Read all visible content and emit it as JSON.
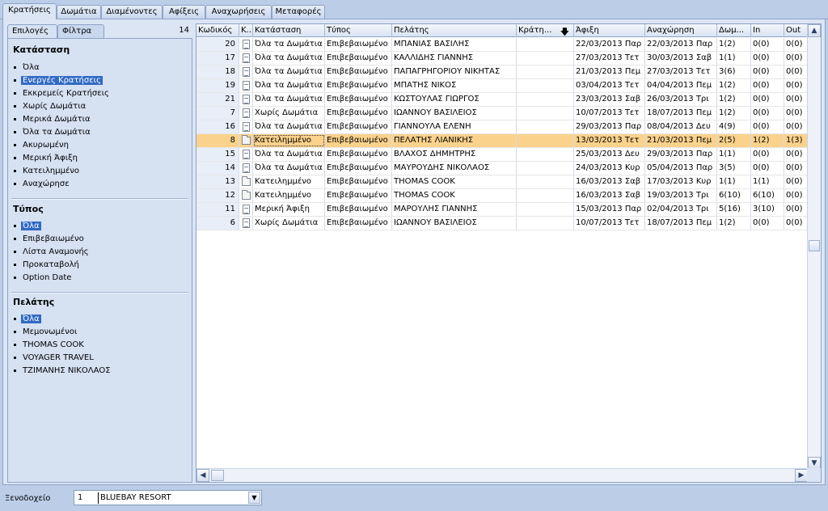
{
  "top_tabs": [
    {
      "label": "Κρατήσεις",
      "active": true
    },
    {
      "label": "Δωμάτια",
      "active": false
    },
    {
      "label": "Διαμένοντες",
      "active": false
    },
    {
      "label": "Αφίξεις",
      "active": false
    },
    {
      "label": "Αναχωρήσεις",
      "active": false
    },
    {
      "label": "Μεταφορές",
      "active": false
    }
  ],
  "left_panel": {
    "tabs": [
      {
        "label": "Επιλογές",
        "active": true
      },
      {
        "label": "Φίλτρα",
        "active": false
      }
    ],
    "count": "14",
    "status_section": {
      "title": "Κατάσταση",
      "items": [
        "Όλα",
        "Ενεργές Κρατήσεις",
        "Εκκρεμείς Κρατήσεις",
        "Χωρίς Δωμάτια",
        "Μερικά Δωμάτια",
        "Όλα τα Δωμάτια",
        "Ακυρωμένη",
        "Μερική Άφιξη",
        "Κατειλημμένο",
        "Αναχώρησε"
      ],
      "selected_index": 1
    },
    "type_section": {
      "title": "Τύπος",
      "items": [
        "Όλα",
        "Επιβεβαιωμένο",
        "Λίστα Αναμονής",
        "Προκαταβολή",
        "Option Date"
      ],
      "selected_index": 0
    },
    "customer_section": {
      "title": "Πελάτης",
      "items": [
        "Όλα",
        "Μεμονωμένοι",
        "THOMAS COOK",
        "VOYAGER TRAVEL",
        "ΤΖΙΜΑΝΗΣ ΝΙΚΟΛΑΟΣ"
      ],
      "selected_index": 0
    }
  },
  "grid": {
    "columns": [
      "Κωδικός",
      "Κ...",
      "Κατάσταση",
      "Τύπος",
      "Πελάτης",
      "Κράτη...",
      "Άφιξη",
      "Αναχώρηση",
      "Δωμ...",
      "In",
      "Out"
    ],
    "sort_icon": "sort-down-arrow",
    "rows": [
      {
        "id": "20",
        "icon": "document",
        "status": "Όλα τα Δωμάτια",
        "type": "Επιβεβαιωμένο",
        "customer": "ΜΠΑΝΙΑΣ ΒΑΣΙΛΗΣ",
        "booked": "",
        "arrival": "22/03/2013 Παρ",
        "departure": "22/03/2013 Παρ",
        "rooms": "1(2)",
        "in": "0(0)",
        "out": "0(0)"
      },
      {
        "id": "17",
        "icon": "document",
        "status": "Όλα τα Δωμάτια",
        "type": "Επιβεβαιωμένο",
        "customer": "ΚΑΛΛΙΔΗΣ ΓΙΑΝΝΗΣ",
        "booked": "",
        "arrival": "27/03/2013 Τετ",
        "departure": "30/03/2013 Σαβ",
        "rooms": "1(1)",
        "in": "0(0)",
        "out": "0(0)"
      },
      {
        "id": "18",
        "icon": "document",
        "status": "Όλα τα Δωμάτια",
        "type": "Επιβεβαιωμένο",
        "customer": "ΠΑΠΑΓΡΗΓΟΡΙΟΥ ΝΙΚΗΤΑΣ",
        "booked": "",
        "arrival": "21/03/2013 Πεμ",
        "departure": "27/03/2013 Τετ",
        "rooms": "3(6)",
        "in": "0(0)",
        "out": "0(0)"
      },
      {
        "id": "19",
        "icon": "document",
        "status": "Όλα τα Δωμάτια",
        "type": "Επιβεβαιωμένο",
        "customer": "ΜΠΑΤΗΣ ΝΙΚΟΣ",
        "booked": "",
        "arrival": "03/04/2013 Τετ",
        "departure": "04/04/2013 Πεμ",
        "rooms": "1(2)",
        "in": "0(0)",
        "out": "0(0)"
      },
      {
        "id": "21",
        "icon": "document",
        "status": "Όλα τα Δωμάτια",
        "type": "Επιβεβαιωμένο",
        "customer": "ΚΩΣΤΟΥΛΑΣ ΓΙΩΡΓΟΣ",
        "booked": "",
        "arrival": "23/03/2013 Σαβ",
        "departure": "26/03/2013 Τρι",
        "rooms": "1(2)",
        "in": "0(0)",
        "out": "0(0)"
      },
      {
        "id": "7",
        "icon": "document",
        "status": "Χωρίς Δωμάτια",
        "type": "Επιβεβαιωμένο",
        "customer": "ΙΩΑΝΝΟΥ ΒΑΣΙΛΕΙΟΣ",
        "booked": "",
        "arrival": "10/07/2013 Τετ",
        "departure": "18/07/2013 Πεμ",
        "rooms": "1(2)",
        "in": "0(0)",
        "out": "0(0)"
      },
      {
        "id": "16",
        "icon": "document",
        "status": "Όλα τα Δωμάτια",
        "type": "Επιβεβαιωμένο",
        "customer": "ΓΙΑΝΝΟΥΛΑ ΕΛΕΝΗ",
        "booked": "",
        "arrival": "29/03/2013 Παρ",
        "departure": "08/04/2013 Δευ",
        "rooms": "4(9)",
        "in": "0(0)",
        "out": "0(0)"
      },
      {
        "id": "8",
        "icon": "folder",
        "status": "Κατειλημμένο",
        "type": "Επιβεβαιωμένο",
        "customer": "ΠΕΛΑΤΗΣ ΛΙΑΝΙΚΗΣ",
        "booked": "",
        "arrival": "13/03/2013 Τετ",
        "departure": "21/03/2013 Πεμ",
        "rooms": "2(5)",
        "in": "1(2)",
        "out": "1(3)",
        "selected": true
      },
      {
        "id": "15",
        "icon": "document",
        "status": "Όλα τα Δωμάτια",
        "type": "Επιβεβαιωμένο",
        "customer": "ΒΛΑΧΟΣ ΔΗΜΗΤΡΗΣ",
        "booked": "",
        "arrival": "25/03/2013 Δευ",
        "departure": "29/03/2013 Παρ",
        "rooms": "1(1)",
        "in": "0(0)",
        "out": "0(0)"
      },
      {
        "id": "14",
        "icon": "document",
        "status": "Όλα τα Δωμάτια",
        "type": "Επιβεβαιωμένο",
        "customer": "ΜΑΥΡΟΥΔΗΣ ΝΙΚΟΛΑΟΣ",
        "booked": "",
        "arrival": "24/03/2013 Κυρ",
        "departure": "05/04/2013 Παρ",
        "rooms": "3(5)",
        "in": "0(0)",
        "out": "0(0)"
      },
      {
        "id": "13",
        "icon": "folder",
        "status": "Κατειλημμένο",
        "type": "Επιβεβαιωμένο",
        "customer": "THOMAS COOK",
        "booked": "",
        "arrival": "16/03/2013 Σαβ",
        "departure": "17/03/2013 Κυρ",
        "rooms": "1(1)",
        "in": "1(1)",
        "out": "0(0)"
      },
      {
        "id": "12",
        "icon": "folder",
        "status": "Κατειλημμένο",
        "type": "Επιβεβαιωμένο",
        "customer": "THOMAS COOK",
        "booked": "",
        "arrival": "16/03/2013 Σαβ",
        "departure": "19/03/2013 Τρι",
        "rooms": "6(10)",
        "in": "6(10)",
        "out": "0(0)"
      },
      {
        "id": "11",
        "icon": "document-plain",
        "status": "Μερική Άφιξη",
        "type": "Επιβεβαιωμένο",
        "customer": "ΜΑΡΟΥΛΗΣ ΓΙΑΝΝΗΣ",
        "booked": "",
        "arrival": "15/03/2013 Παρ",
        "departure": "02/04/2013 Τρι",
        "rooms": "5(16)",
        "in": "3(10)",
        "out": "0(0)"
      },
      {
        "id": "6",
        "icon": "document",
        "status": "Χωρίς Δωμάτια",
        "type": "Επιβεβαιωμένο",
        "customer": "ΙΩΑΝΝΟΥ ΒΑΣΙΛΕΙΟΣ",
        "booked": "",
        "arrival": "10/07/2013 Τετ",
        "departure": "18/07/2013 Πεμ",
        "rooms": "1(2)",
        "in": "0(0)",
        "out": "0(0)"
      }
    ]
  },
  "bottom": {
    "hotel_label": "Ξενοδοχείο",
    "hotel_number": "1",
    "hotel_name": "BLUEBAY RESORT"
  }
}
